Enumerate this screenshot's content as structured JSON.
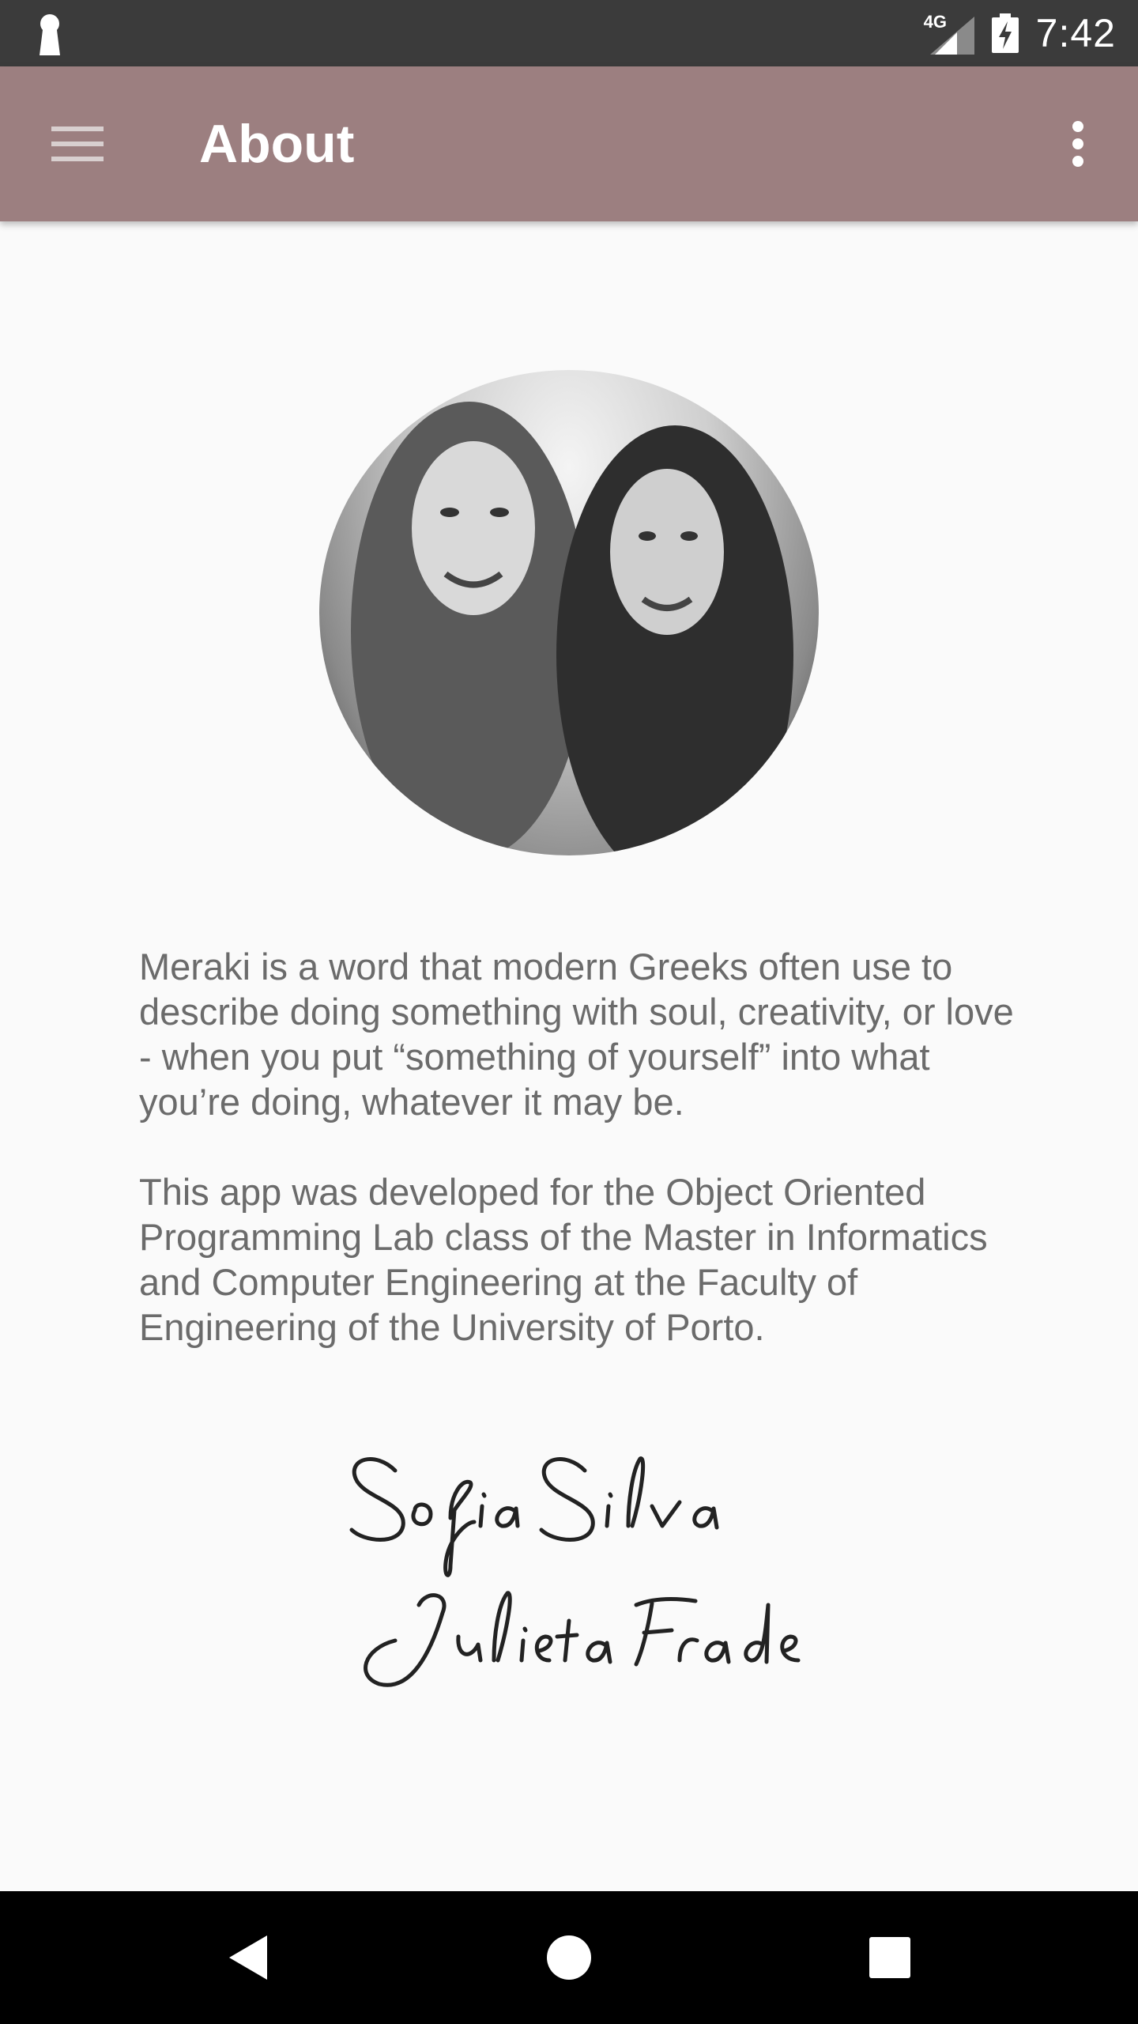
{
  "status_bar": {
    "network_label": "4G",
    "time": "7:42",
    "icons": [
      "keyhole-icon",
      "signal-icon",
      "battery-charging-icon"
    ]
  },
  "app_bar": {
    "title": "About",
    "menu_icon": "hamburger-menu-icon",
    "more_icon": "more-vert-icon",
    "background_color": "#9c7f80"
  },
  "content": {
    "paragraphs": [
      "Meraki is a word that modern Greeks often use to describe doing something with soul, creativity, or love - when you put “something of yourself” into what you’re doing, whatever it may be.",
      "This app was developed for the Object Oriented Programming Lab class of the Master in Informatics and Computer Engineering at the Faculty of Engineering of the University of Porto."
    ],
    "signature_names": [
      "Sofia Silva",
      "Julieta Frade"
    ]
  },
  "nav_bar": {
    "icons": [
      "back-icon",
      "home-icon",
      "recents-icon"
    ]
  }
}
